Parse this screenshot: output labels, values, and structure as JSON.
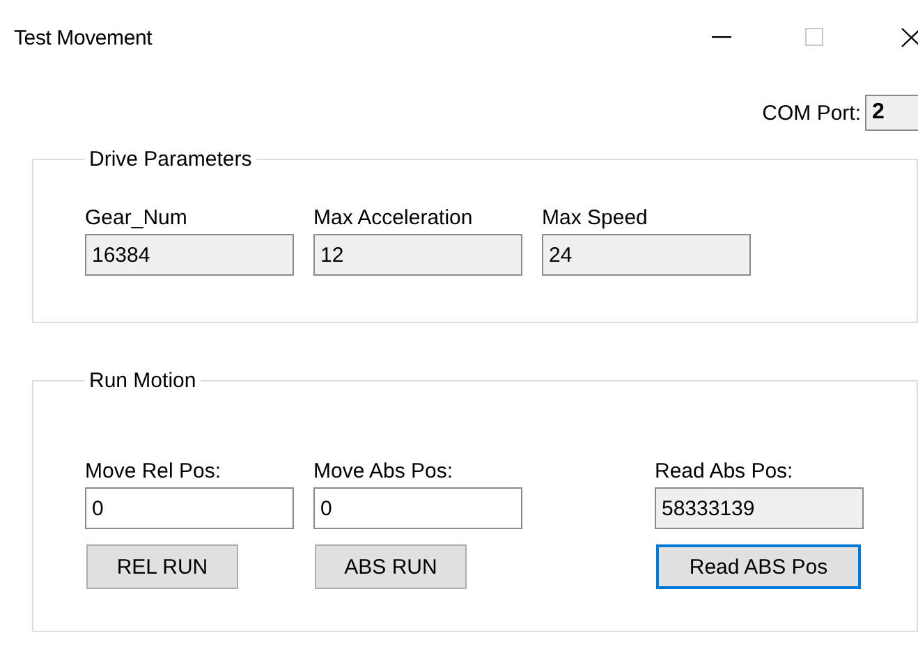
{
  "window": {
    "title": "Test Movement"
  },
  "com_port": {
    "label": "COM Port:",
    "value": "2"
  },
  "drive_parameters": {
    "title": "Drive Parameters",
    "fields": [
      {
        "label": "Gear_Num",
        "value": "16384",
        "readonly": true
      },
      {
        "label": "Max Acceleration",
        "value": "12",
        "readonly": true
      },
      {
        "label": "Max Speed",
        "value": "24",
        "readonly": true
      }
    ]
  },
  "run_motion": {
    "title": "Run Motion",
    "columns": [
      {
        "label": "Move Rel Pos:",
        "value": "0",
        "readonly": false,
        "button": {
          "label": "REL RUN",
          "focused": false
        }
      },
      {
        "label": "Move Abs Pos:",
        "value": "0",
        "readonly": false,
        "button": {
          "label": "ABS RUN",
          "focused": false
        }
      },
      {
        "label": "Read Abs Pos:",
        "value": "58333139",
        "readonly": true,
        "button": {
          "label": "Read ABS Pos",
          "focused": true
        }
      }
    ]
  }
}
